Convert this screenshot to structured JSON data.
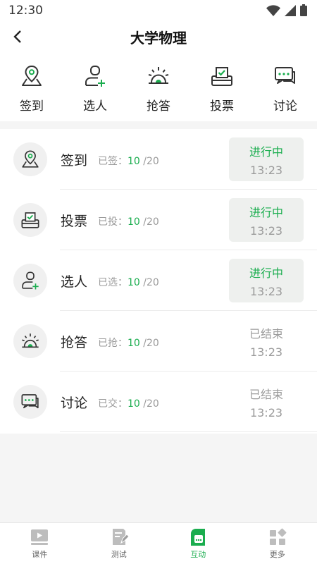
{
  "status_bar": {
    "time": "12:30"
  },
  "header": {
    "title": "大学物理"
  },
  "quick_actions": [
    {
      "label": "签到",
      "icon": "location-pin-icon"
    },
    {
      "label": "选人",
      "icon": "person-add-icon"
    },
    {
      "label": "抢答",
      "icon": "buzzer-icon"
    },
    {
      "label": "投票",
      "icon": "ballot-box-icon"
    },
    {
      "label": "讨论",
      "icon": "chat-bubble-icon"
    }
  ],
  "activities": [
    {
      "title": "签到",
      "stat_prefix": "已签：",
      "count": "10",
      "total": "/20",
      "status": "进行中",
      "time": "13:23",
      "state": "active",
      "icon": "location-pin-icon"
    },
    {
      "title": "投票",
      "stat_prefix": "已投：",
      "count": "10",
      "total": "/20",
      "status": "进行中",
      "time": "13:23",
      "state": "active",
      "icon": "ballot-box-icon"
    },
    {
      "title": "选人",
      "stat_prefix": "已选：",
      "count": "10",
      "total": "/20",
      "status": "进行中",
      "time": "13:23",
      "state": "active",
      "icon": "person-add-icon"
    },
    {
      "title": "抢答",
      "stat_prefix": "已抢：",
      "count": "10",
      "total": "/20",
      "status": "已结束",
      "time": "13:23",
      "state": "ended",
      "icon": "buzzer-icon"
    },
    {
      "title": "讨论",
      "stat_prefix": "已交：",
      "count": "10",
      "total": "/20",
      "status": "已结束",
      "time": "13:23",
      "state": "ended",
      "icon": "chat-bubble-icon"
    }
  ],
  "tabs": [
    {
      "label": "课件",
      "icon": "video-play-icon",
      "active": false
    },
    {
      "label": "测试",
      "icon": "document-edit-icon",
      "active": false
    },
    {
      "label": "互动",
      "icon": "interaction-icon",
      "active": true
    },
    {
      "label": "更多",
      "icon": "grid-more-icon",
      "active": false
    }
  ],
  "colors": {
    "accent": "#1aad4e",
    "muted": "#9a9a9a",
    "badge_bg": "#eef0ee"
  }
}
